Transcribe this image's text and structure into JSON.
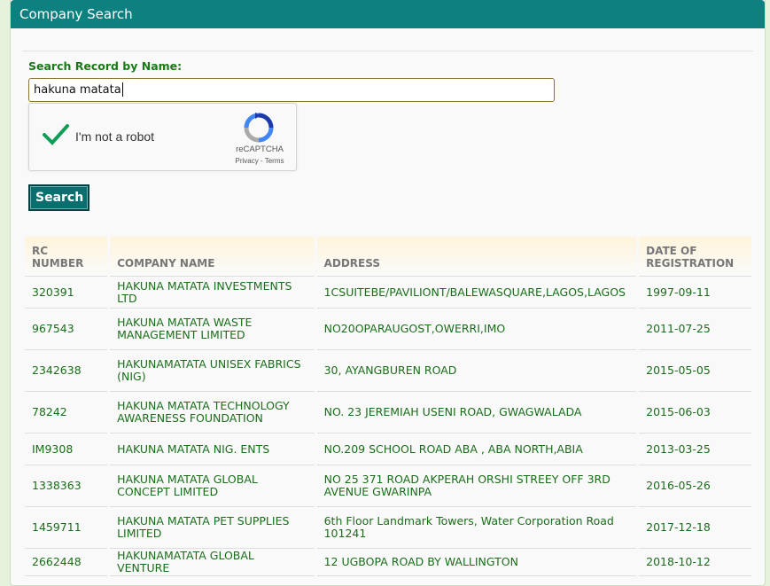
{
  "panel": {
    "title": "Company Search"
  },
  "search": {
    "label": "Search Record by Name:",
    "value": "hakuna matata",
    "button_label": "Search"
  },
  "captcha": {
    "checkbox_label": "I'm not a robot",
    "brand": "reCAPTCHA",
    "links": "Privacy - Terms",
    "checked": true
  },
  "table": {
    "headers": [
      "RC NUMBER",
      "COMPANY NAME",
      "ADDRESS",
      "DATE OF REGISTRATION"
    ],
    "rows": [
      {
        "rc": "320391",
        "name": "HAKUNA MATATA INVESTMENTS LTD",
        "address": "1CSUITEBE/PAVILIONT/BALEWASQUARE,LAGOS,LAGOS",
        "date": "1997-09-11"
      },
      {
        "rc": "967543",
        "name": "HAKUNA MATATA WASTE MANAGEMENT LIMITED",
        "address": "NO20OPARAUGOST,OWERRI,IMO",
        "date": "2011-07-25"
      },
      {
        "rc": "2342638",
        "name": "HAKUNAMATATA UNISEX FABRICS (NIG)",
        "address": "30, AYANGBUREN ROAD",
        "date": "2015-05-05"
      },
      {
        "rc": "78242",
        "name": "HAKUNA MATATA TECHNOLOGY AWARENESS FOUNDATION",
        "address": "NO. 23 JEREMIAH USENI ROAD, GWAGWALADA",
        "date": "2015-06-03"
      },
      {
        "rc": "IM9308",
        "name": "HAKUNA MATATA NIG. ENTS",
        "address": "NO.209 SCHOOL ROAD ABA , ABA NORTH,ABIA",
        "date": "2013-03-25"
      },
      {
        "rc": "1338363",
        "name": "HAKUNA MATATA GLOBAL CONCEPT LIMITED",
        "address": "NO 25 371 ROAD AKPERAH ORSHI STREEY OFF 3RD AVENUE GWARINPA",
        "date": "2016-05-26"
      },
      {
        "rc": "1459711",
        "name": "HAKUNA MATATA PET SUPPLIES LIMITED",
        "address": "6th Floor Landmark Towers, Water Corporation Road 101241",
        "date": "2017-12-18"
      },
      {
        "rc": "2662448",
        "name": "HAKUNAMATATA GLOBAL VENTURE",
        "address": "12 UGBOPA ROAD BY WALLINGTON",
        "date": "2018-10-12"
      }
    ]
  },
  "colors": {
    "header_bg": "#0d8080",
    "accent_green": "#1a7a1a",
    "button_bg": "#0b6e6e"
  }
}
